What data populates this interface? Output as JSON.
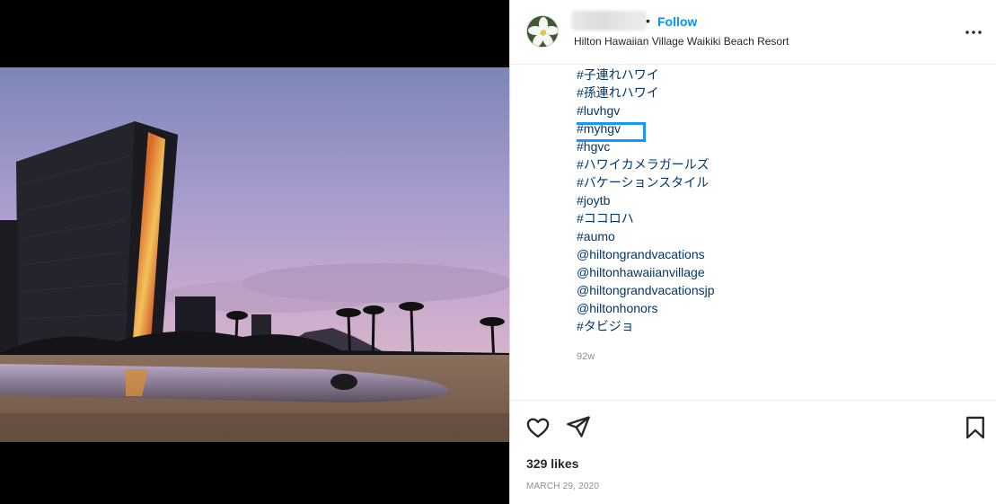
{
  "post": {
    "location": "Hilton Hawaiian Village Waikiki Beach Resort",
    "follow_label": "Follow",
    "separator": "•",
    "caption_tags": [
      "#子連れハワイ",
      "#孫連れハワイ",
      "#luvhgv",
      "#myhgv",
      "#hgvc",
      "#ハワイカメラガールズ",
      "#バケーションスタイル",
      "#joytb",
      "#ココロハ",
      "#aumo",
      "@hiltongrandvacations",
      "@hiltonhawaiianvillage",
      "@hiltongrandvacationsjp",
      "@hiltonhonors",
      "#タビジョ"
    ],
    "age": "92w",
    "likes": "329 likes",
    "date": "MARCH 29, 2020"
  },
  "icons": {
    "more": "more-options-icon",
    "like": "heart-icon",
    "share": "send-icon",
    "save": "bookmark-icon"
  },
  "colors": {
    "follow": "#0095f6",
    "hashtag": "#00376b",
    "highlight_box": "#1796ff",
    "muted": "#8e8e8e"
  }
}
